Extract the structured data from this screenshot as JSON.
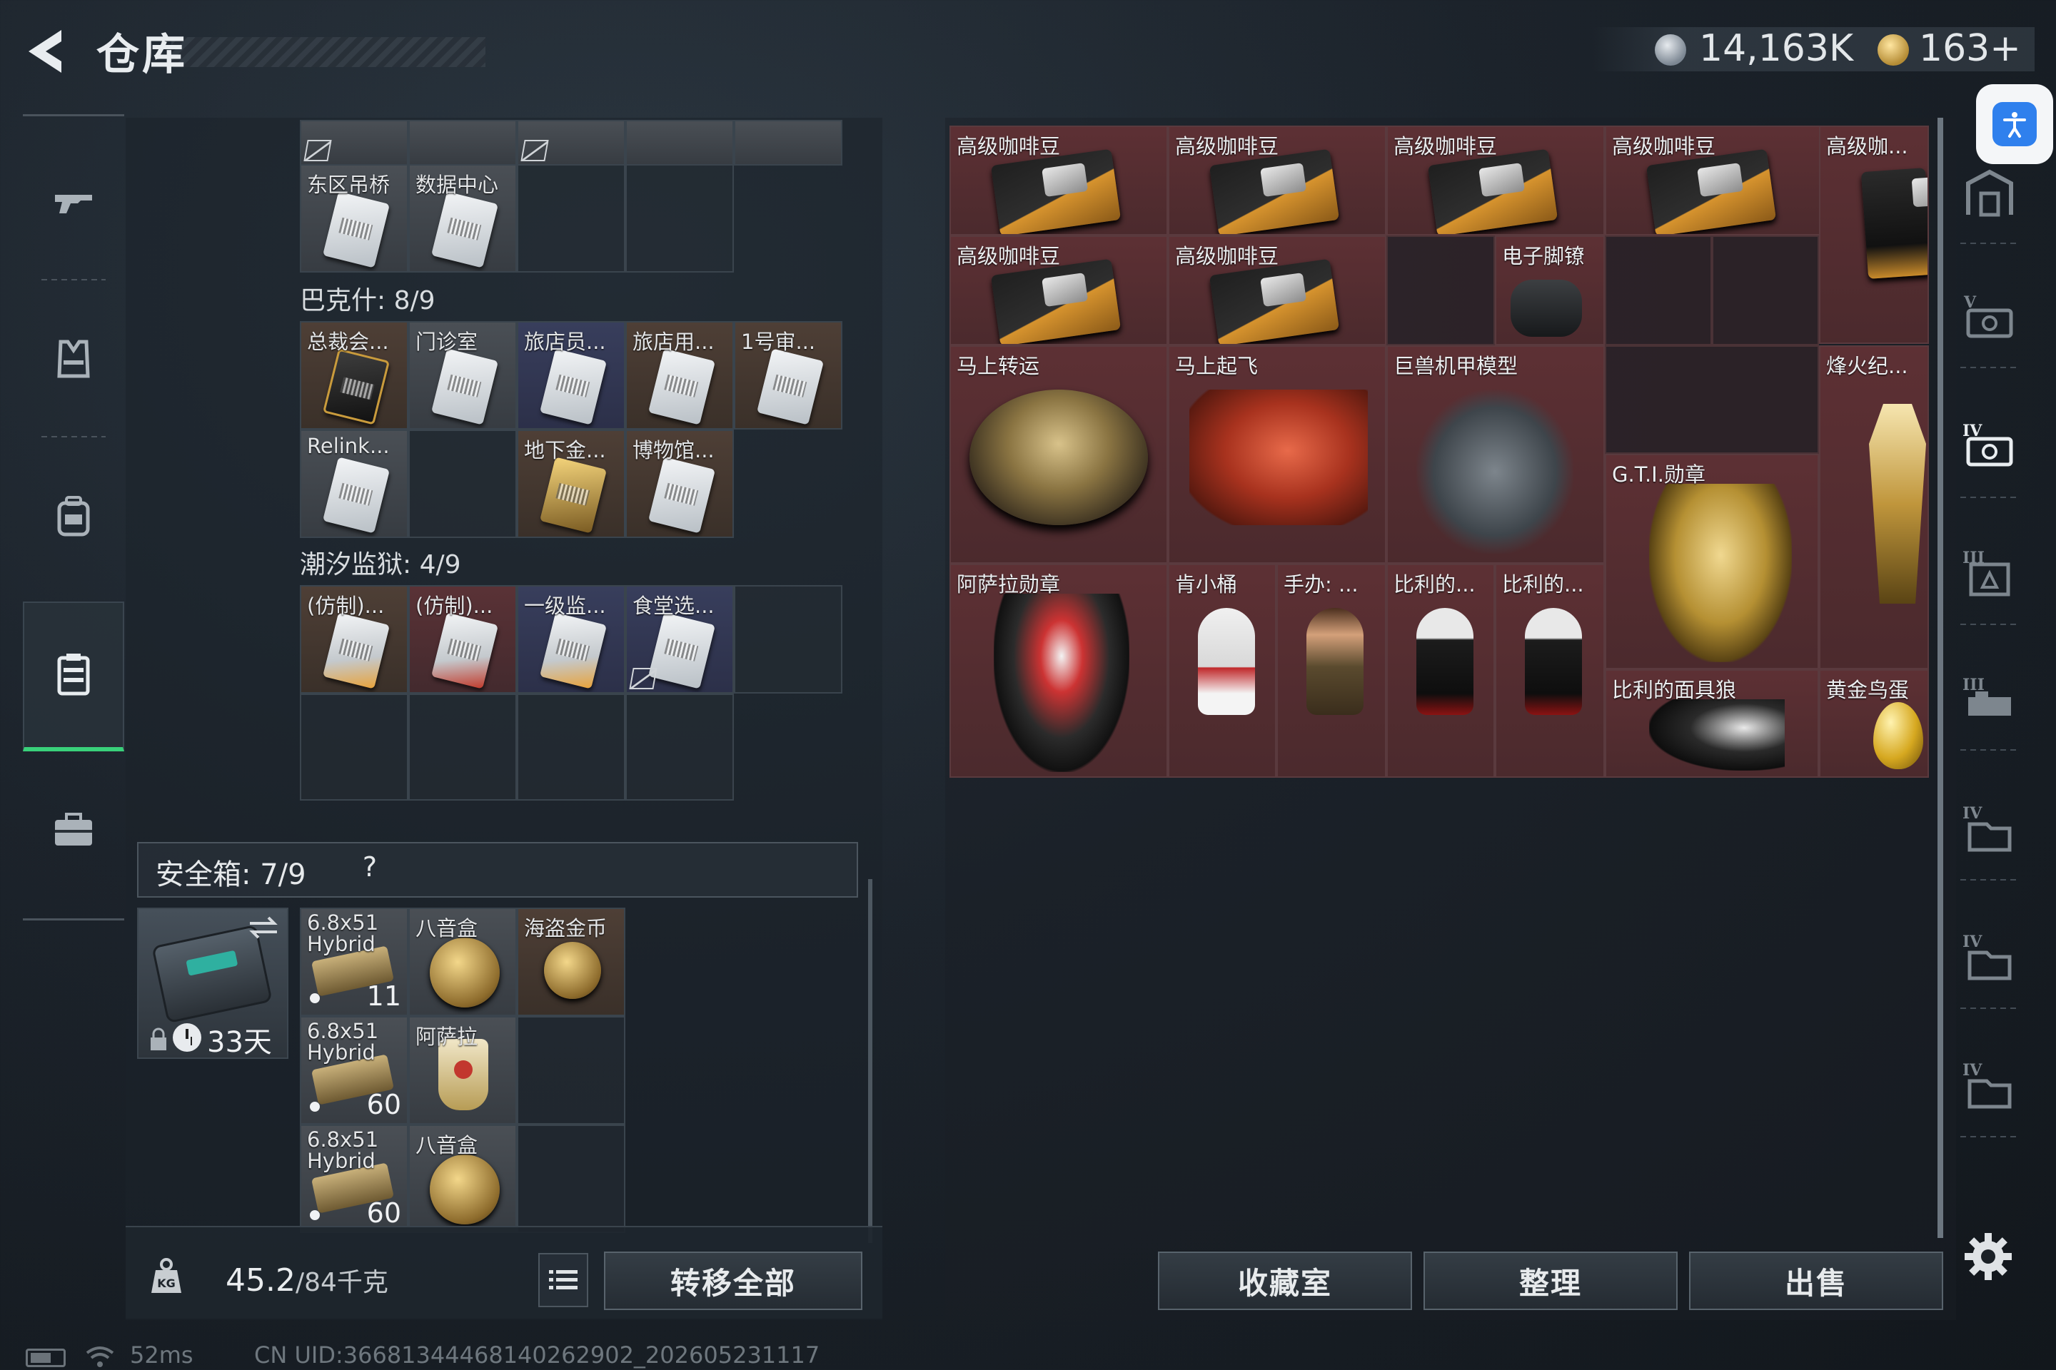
{
  "header": {
    "title": "仓库",
    "currency_silver": "14,163K",
    "currency_gold": "163+"
  },
  "left_nav": {
    "items": [
      {
        "name": "weapons",
        "icon": "gun-icon"
      },
      {
        "name": "armor",
        "icon": "armor-vest-icon"
      },
      {
        "name": "backpack",
        "icon": "backpack-icon"
      },
      {
        "name": "keycards",
        "icon": "keycard-case-icon",
        "active": true
      },
      {
        "name": "toolbox",
        "icon": "briefcase-icon"
      }
    ]
  },
  "keycards": {
    "top_row": {
      "cells": [
        {
          "label": "东区吊桥"
        },
        {
          "label": "数据中心"
        }
      ]
    },
    "bakesh": {
      "title": "巴克什: 8/9",
      "cells": [
        {
          "label": "总裁会..."
        },
        {
          "label": "门诊室"
        },
        {
          "label": "旅店员..."
        },
        {
          "label": "旅店用..."
        },
        {
          "label": "1号审..."
        },
        {
          "label": "Relink..."
        },
        {
          "label": "地下金..."
        },
        {
          "label": "博物馆..."
        }
      ]
    },
    "tidal_prison": {
      "title": "潮汐监狱: 4/9",
      "cells": [
        {
          "label": "(仿制)..."
        },
        {
          "label": "(仿制)..."
        },
        {
          "label": "一级监..."
        },
        {
          "label": "食堂选..."
        }
      ]
    }
  },
  "safe_box": {
    "title": "安全箱: 7/9",
    "help": "?",
    "days": "33天",
    "items": [
      {
        "label": "6.8x51 Hybrid",
        "count": "11"
      },
      {
        "label": "八音盒"
      },
      {
        "label": "海盗金币"
      },
      {
        "label": "6.8x51 Hybrid",
        "count": "60"
      },
      {
        "label": "阿萨拉"
      },
      {
        "label": "6.8x51 Hybrid",
        "count": "60"
      },
      {
        "label": "八音盒"
      }
    ]
  },
  "footer_left": {
    "weight_value": "45.2",
    "weight_unit": "/84千克",
    "transfer_all": "转移全部"
  },
  "stash": {
    "items": [
      {
        "label": "高级咖啡豆"
      },
      {
        "label": "高级咖啡豆"
      },
      {
        "label": "高级咖啡豆"
      },
      {
        "label": "高级咖啡豆"
      },
      {
        "label": "高级咖..."
      },
      {
        "label": "高级咖啡豆"
      },
      {
        "label": "高级咖啡豆"
      },
      {
        "label": "电子脚镣"
      },
      {
        "label": "马上转运"
      },
      {
        "label": "马上起飞"
      },
      {
        "label": "巨兽机甲模型"
      },
      {
        "label": "烽火纪..."
      },
      {
        "label": "G.T.I.勋章"
      },
      {
        "label": "阿萨拉勋章"
      },
      {
        "label": "肯小桶"
      },
      {
        "label": "手办: ..."
      },
      {
        "label": "比利的..."
      },
      {
        "label": "比利的..."
      },
      {
        "label": "比利的面具狼"
      },
      {
        "label": "黄金鸟蛋"
      }
    ]
  },
  "footer_right": {
    "collection": "收藏室",
    "organize": "整理",
    "sell": "出售"
  },
  "right_nav": {
    "items": [
      {
        "icon": "storage-home-icon"
      },
      {
        "icon": "stash-tier-5-icon"
      },
      {
        "icon": "stash-tier-4-icon"
      },
      {
        "icon": "stash-tier-3-icon"
      },
      {
        "icon": "stash-tier-3b-icon"
      },
      {
        "icon": "stash-tier-4b-icon"
      },
      {
        "icon": "stash-tier-4c-icon"
      },
      {
        "icon": "stash-tier-4d-icon"
      }
    ]
  },
  "status_bar": {
    "ping": "52ms",
    "uid": "CN UID:3668134446814026290​2_202605231117"
  },
  "colors": {
    "accent_green": "#39d17a",
    "item_red": "#5d3034",
    "accessibility_blue": "#2f80ed"
  }
}
